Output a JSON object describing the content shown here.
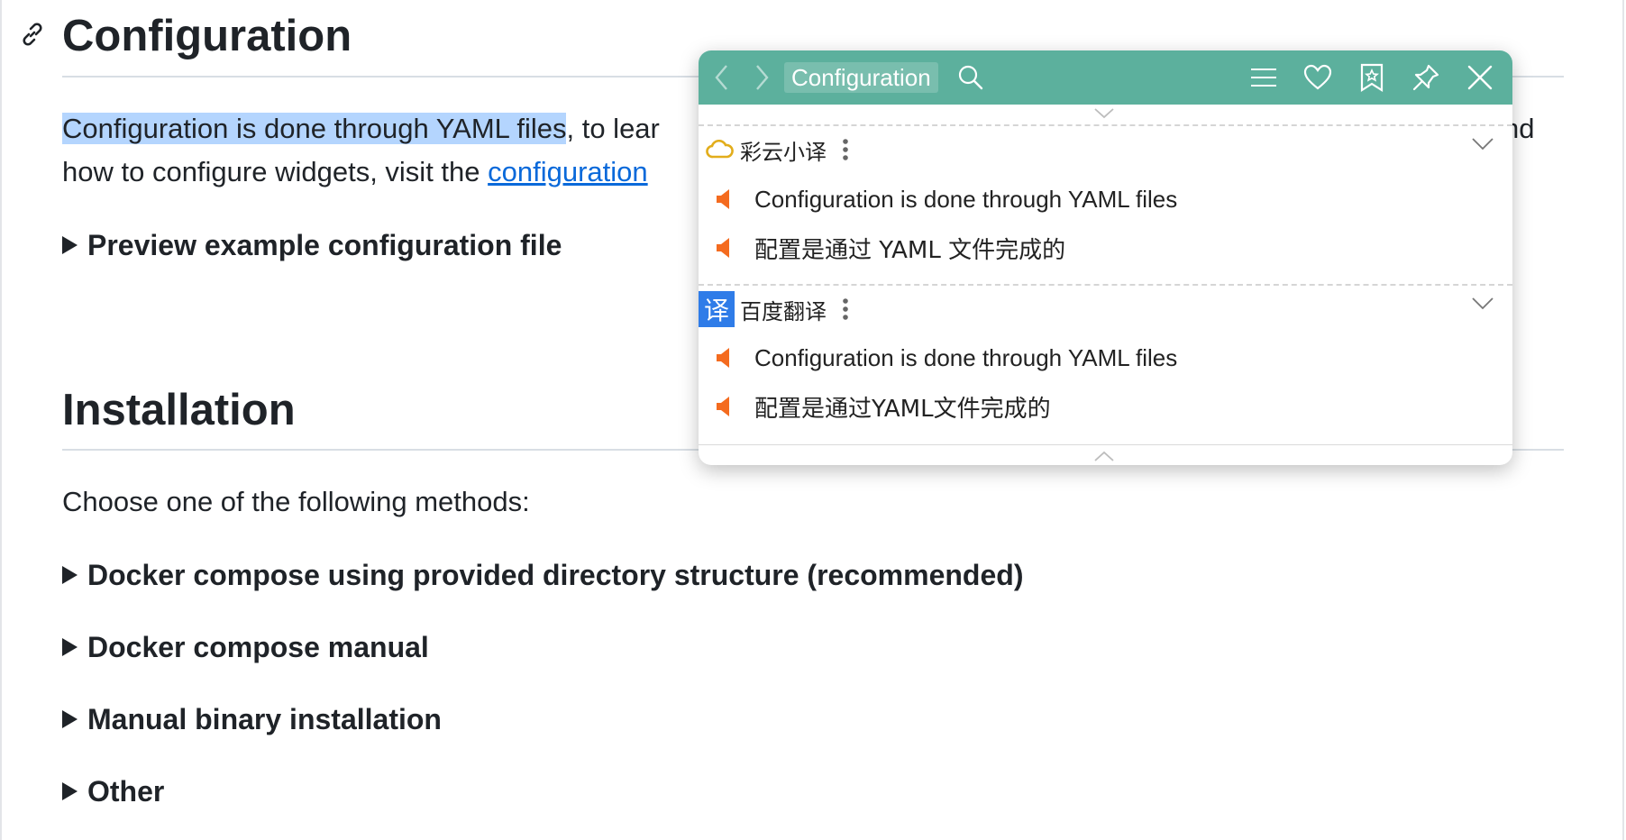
{
  "doc": {
    "configuration": {
      "heading": "Configuration",
      "para_highlight": "Configuration is done through YAML files",
      "para_rest_1": ", to lear",
      "para_tail_1": "nd",
      "para_line2_prefix": "how to configure widgets, visit the ",
      "para_link": "configuration",
      "details_label": "Preview example configuration file"
    },
    "installation": {
      "heading": "Installation",
      "intro": "Choose one of the following methods:",
      "methods": [
        "Docker compose using provided directory structure (recommended)",
        "Docker compose manual",
        "Manual binary installation",
        "Other"
      ]
    }
  },
  "popup": {
    "query": "Configuration",
    "engines": [
      {
        "name": "彩云小译",
        "logo_icon": "cloud-icon",
        "lines": [
          "Configuration is done through YAML files",
          "配置是通过 YAML 文件完成的"
        ]
      },
      {
        "name": "百度翻译",
        "logo_text": "译",
        "lines": [
          "Configuration is done through YAML files",
          "配置是通过YAML文件完成的"
        ]
      }
    ]
  },
  "colors": {
    "popup_header": "#5cb09d",
    "speaker": "#f46b1f",
    "link": "#0969da",
    "highlight": "#b4d5fe",
    "baidu_logo": "#2f7ce8"
  }
}
